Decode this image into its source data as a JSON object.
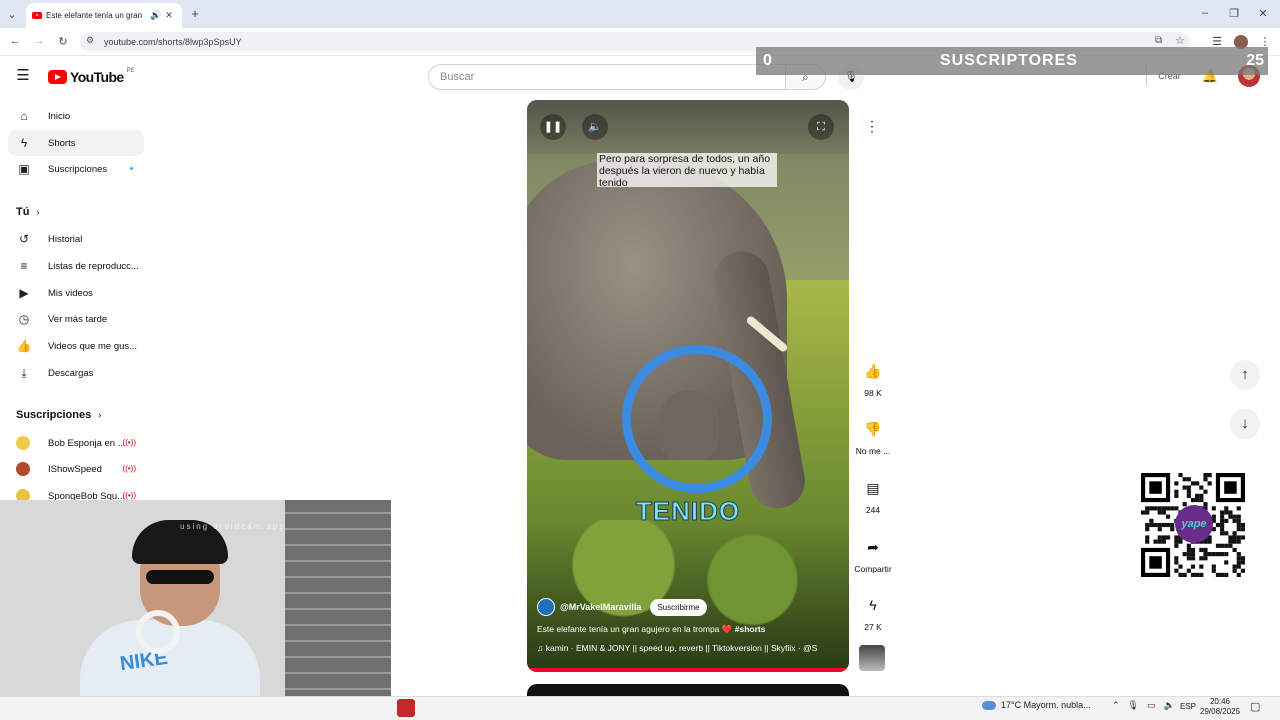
{
  "browser": {
    "tab_title": "Este elefante tenía un gran",
    "url": "youtube.com/shorts/8lwp3pSpsUY",
    "icons": [
      "chevron-down-icon",
      "speaker-icon",
      "close-icon",
      "plus-icon",
      "back-icon",
      "forward-icon",
      "reload-icon",
      "site-info-icon",
      "install-icon",
      "star-icon",
      "reading-list-icon",
      "profile-icon",
      "kebab-icon",
      "minimize-icon",
      "restore-icon",
      "close-window-icon"
    ]
  },
  "header": {
    "logo_text": "YouTube",
    "country": "PE",
    "search_placeholder": "Buscar",
    "create_label": "Crear"
  },
  "sub_overlay": {
    "left_count": "0",
    "label": "SUSCRIPTORES",
    "right_count": "25"
  },
  "sidebar": {
    "items": [
      {
        "label": "Inicio",
        "icon": "home-icon"
      },
      {
        "label": "Shorts",
        "icon": "shorts-icon"
      },
      {
        "label": "Suscripciones",
        "icon": "subscriptions-icon"
      }
    ],
    "you_title": "Tú",
    "you_items": [
      {
        "label": "Historial",
        "icon": "history-icon"
      },
      {
        "label": "Listas de reproducc...",
        "icon": "playlists-icon"
      },
      {
        "label": "Mis videos",
        "icon": "my-videos-icon"
      },
      {
        "label": "Ver más tarde",
        "icon": "watch-later-icon"
      },
      {
        "label": "Videos que me gus...",
        "icon": "liked-icon"
      },
      {
        "label": "Descargas",
        "icon": "download-icon"
      }
    ],
    "subs_title": "Suscripciones",
    "subs": [
      {
        "label": "Bob Esponja en ...",
        "color": "#f2c94c"
      },
      {
        "label": "IShowSpeed",
        "color": "#b04a2a"
      },
      {
        "label": "SpongeBob Squ...",
        "color": "#e9c43b"
      }
    ]
  },
  "webcam": {
    "watermark": "using droidcam.app",
    "shirt_text": "NIKE"
  },
  "player": {
    "caption": "Pero para sorpresa de todos, un año después la vieron de nuevo y había tenido",
    "big_text": "TENIDO",
    "channel": "@MrVakelMaravilla",
    "subscribe_label": "Suscribirme",
    "title": "Este elefante tenía un gran agujero en la trompa",
    "heart": "❤️",
    "hashtag": "#shorts",
    "music": "kamin · EMIN & JONY || speed up, reverb || Tiktokversion || Skyflix · @S",
    "progress": 1.0
  },
  "actions": {
    "likes": "98 K",
    "dislike_label": "No me ...",
    "comments": "244",
    "share_label": "Compartir",
    "remix_count": "27 K"
  },
  "qr": {
    "badge": "yape"
  },
  "taskbar": {
    "weather": "17°C  Mayorm. nubla...",
    "lang": "ESP",
    "time": "20:46",
    "date": "29/08/2025"
  },
  "colors": {
    "youtube_red": "#ff0000",
    "ring_blue": "#3c8be2",
    "progress_red": "#ff0033",
    "big_text_cyan": "#7fe3f2"
  }
}
